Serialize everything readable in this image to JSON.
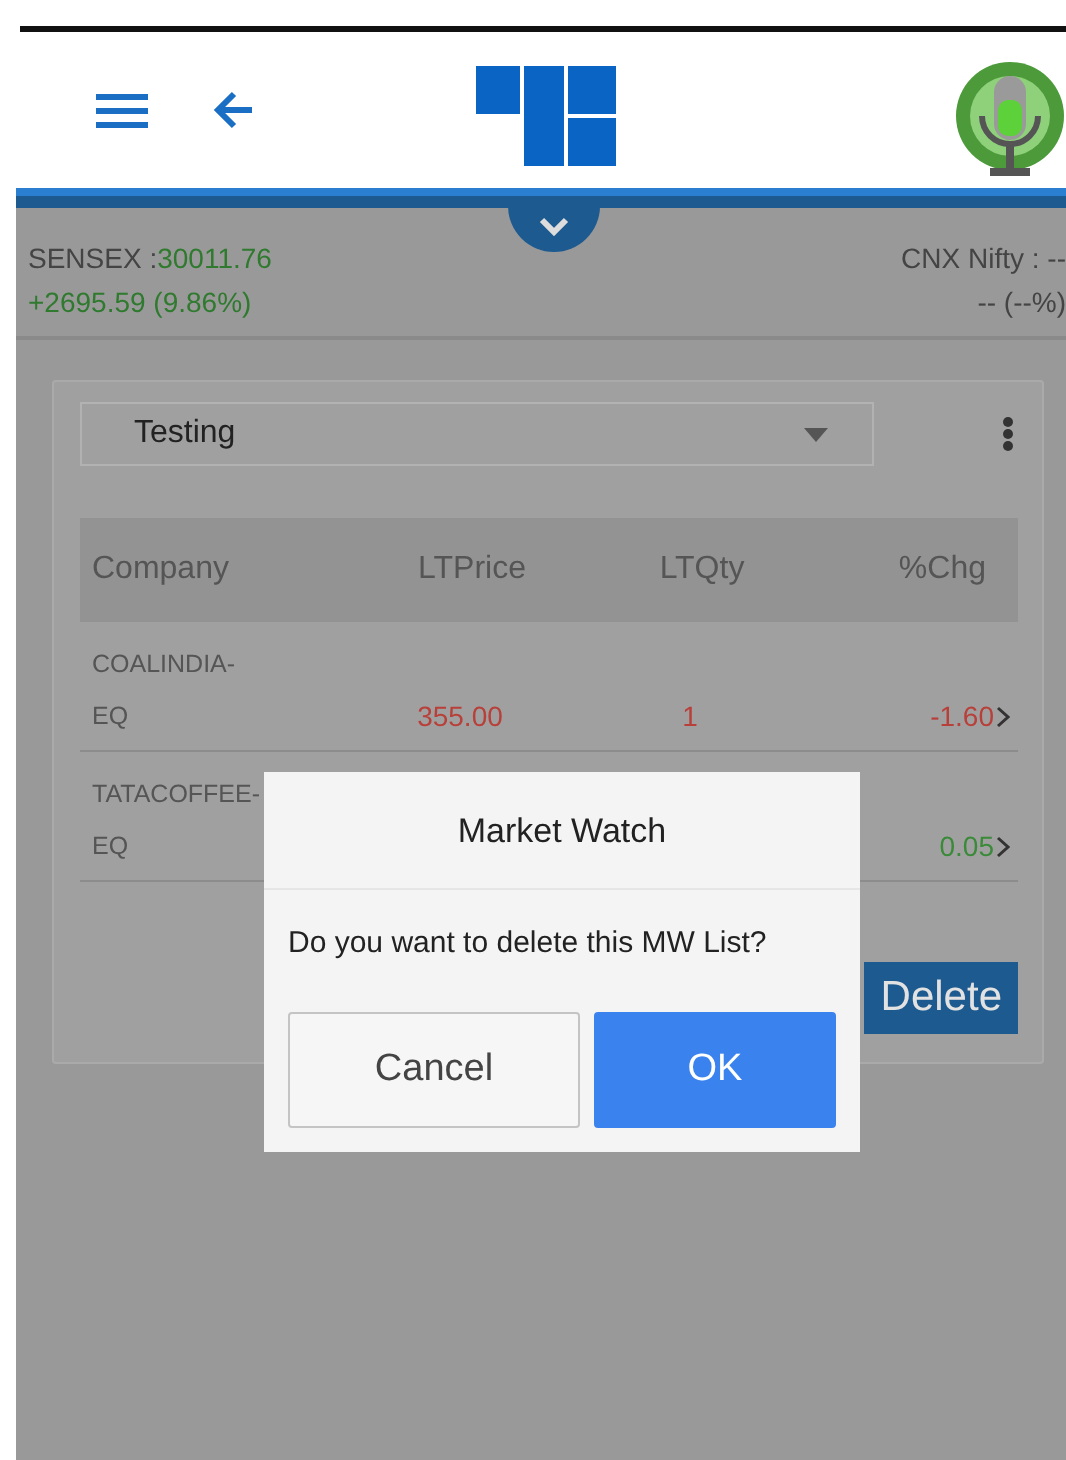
{
  "ticker": {
    "left": {
      "name": "SENSEX :",
      "value": "30011.76",
      "change": "+2695.59 (9.86%)"
    },
    "right": {
      "name": "CNX Nifty : --",
      "change": "-- (--%)"
    }
  },
  "watchlist": {
    "selected_list": "Testing",
    "columns": [
      "Company",
      "LTPrice",
      "LTQty",
      "%Chg"
    ],
    "rows": [
      {
        "company": "COALINDIA-EQ",
        "price": "355.00",
        "qty": "1",
        "change": "-1.60",
        "color": "#b8403a"
      },
      {
        "company": "TATACOFFEE-EQ",
        "change": "0.05",
        "color": "#3a8a3a"
      }
    ],
    "buttons": [
      "Delete"
    ]
  },
  "dialog": {
    "title": "Market Watch",
    "message": "Do you want to delete this MW List?",
    "buttons": [
      "Cancel",
      "OK"
    ]
  }
}
